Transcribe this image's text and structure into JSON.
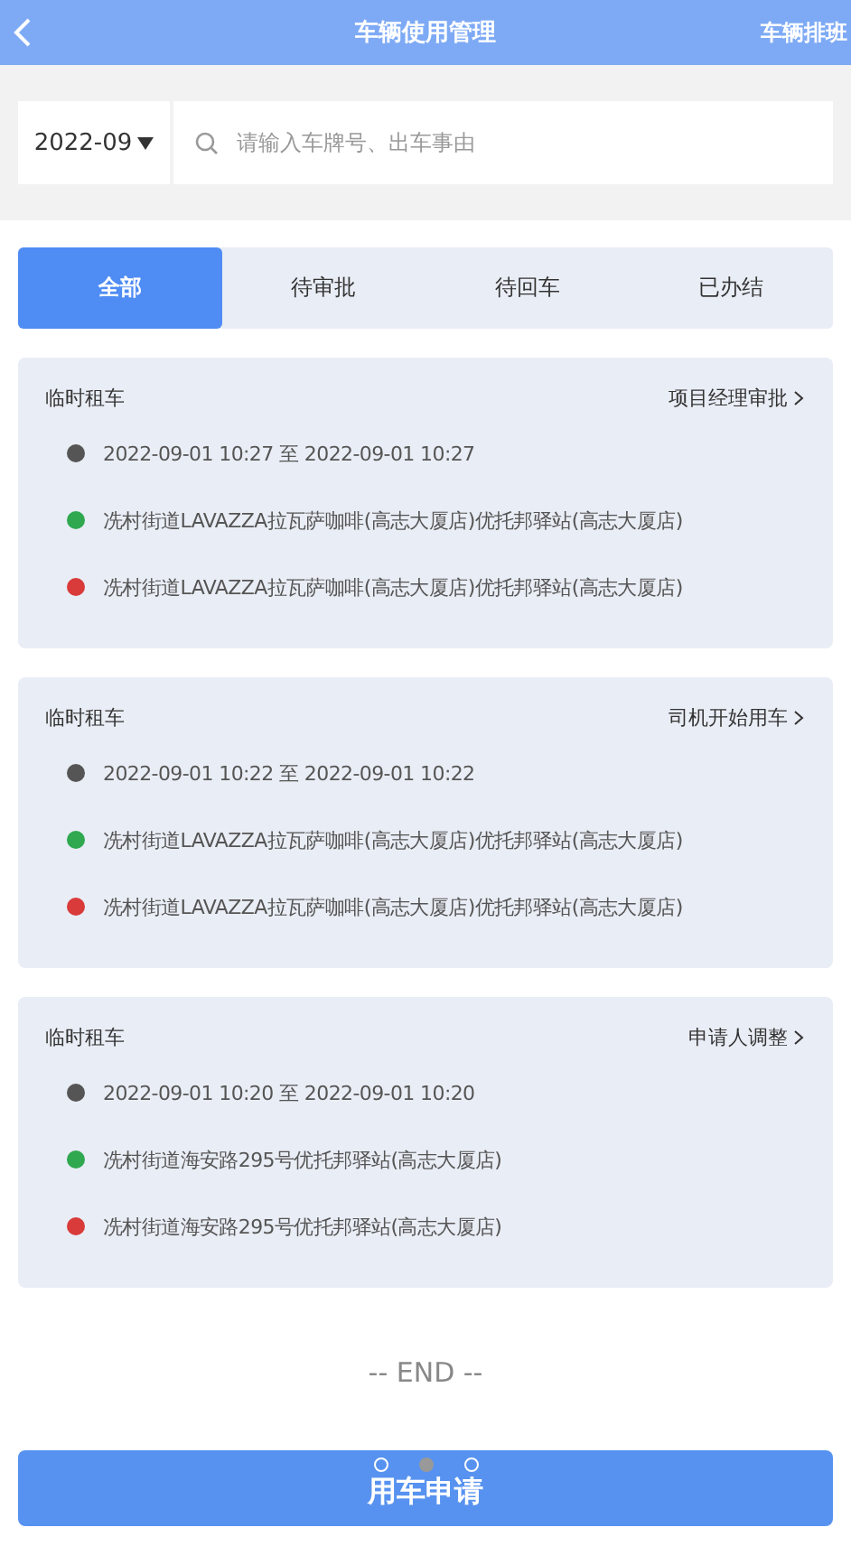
{
  "header": {
    "title": "车辆使用管理",
    "action": "车辆排班"
  },
  "filter": {
    "month": "2022-09",
    "placeholder": "请输入车牌号、出车事由"
  },
  "tabs": [
    {
      "label": "全部",
      "selected": true
    },
    {
      "label": "待审批",
      "selected": false
    },
    {
      "label": "待回车",
      "selected": false
    },
    {
      "label": "已办结",
      "selected": false
    }
  ],
  "cards": [
    {
      "type": "临时租车",
      "status": "项目经理审批",
      "lines": [
        {
          "color": "#555555",
          "text": "2022-09-01 10:27 至 2022-09-01 10:27"
        },
        {
          "color": "#2fa84f",
          "text": "冼村街道LAVAZZA拉瓦萨咖啡(高志大厦店)优托邦驿站(高志大厦店)"
        },
        {
          "color": "#d93a3a",
          "text": "冼村街道LAVAZZA拉瓦萨咖啡(高志大厦店)优托邦驿站(高志大厦店)"
        }
      ]
    },
    {
      "type": "临时租车",
      "status": "司机开始用车",
      "lines": [
        {
          "color": "#555555",
          "text": "2022-09-01 10:22 至 2022-09-01 10:22"
        },
        {
          "color": "#2fa84f",
          "text": "冼村街道LAVAZZA拉瓦萨咖啡(高志大厦店)优托邦驿站(高志大厦店)"
        },
        {
          "color": "#d93a3a",
          "text": "冼村街道LAVAZZA拉瓦萨咖啡(高志大厦店)优托邦驿站(高志大厦店)"
        }
      ]
    },
    {
      "type": "临时租车",
      "status": "申请人调整",
      "lines": [
        {
          "color": "#555555",
          "text": "2022-09-01 10:20 至 2022-09-01 10:20"
        },
        {
          "color": "#2fa84f",
          "text": "冼村街道海安路295号优托邦驿站(高志大厦店)"
        },
        {
          "color": "#d93a3a",
          "text": "冼村街道海安路295号优托邦驿站(高志大厦店)"
        }
      ]
    }
  ],
  "end_text": "-- END --",
  "pager": [
    {
      "selected": false
    },
    {
      "selected": true
    },
    {
      "selected": false
    }
  ],
  "submit": "用车申请"
}
